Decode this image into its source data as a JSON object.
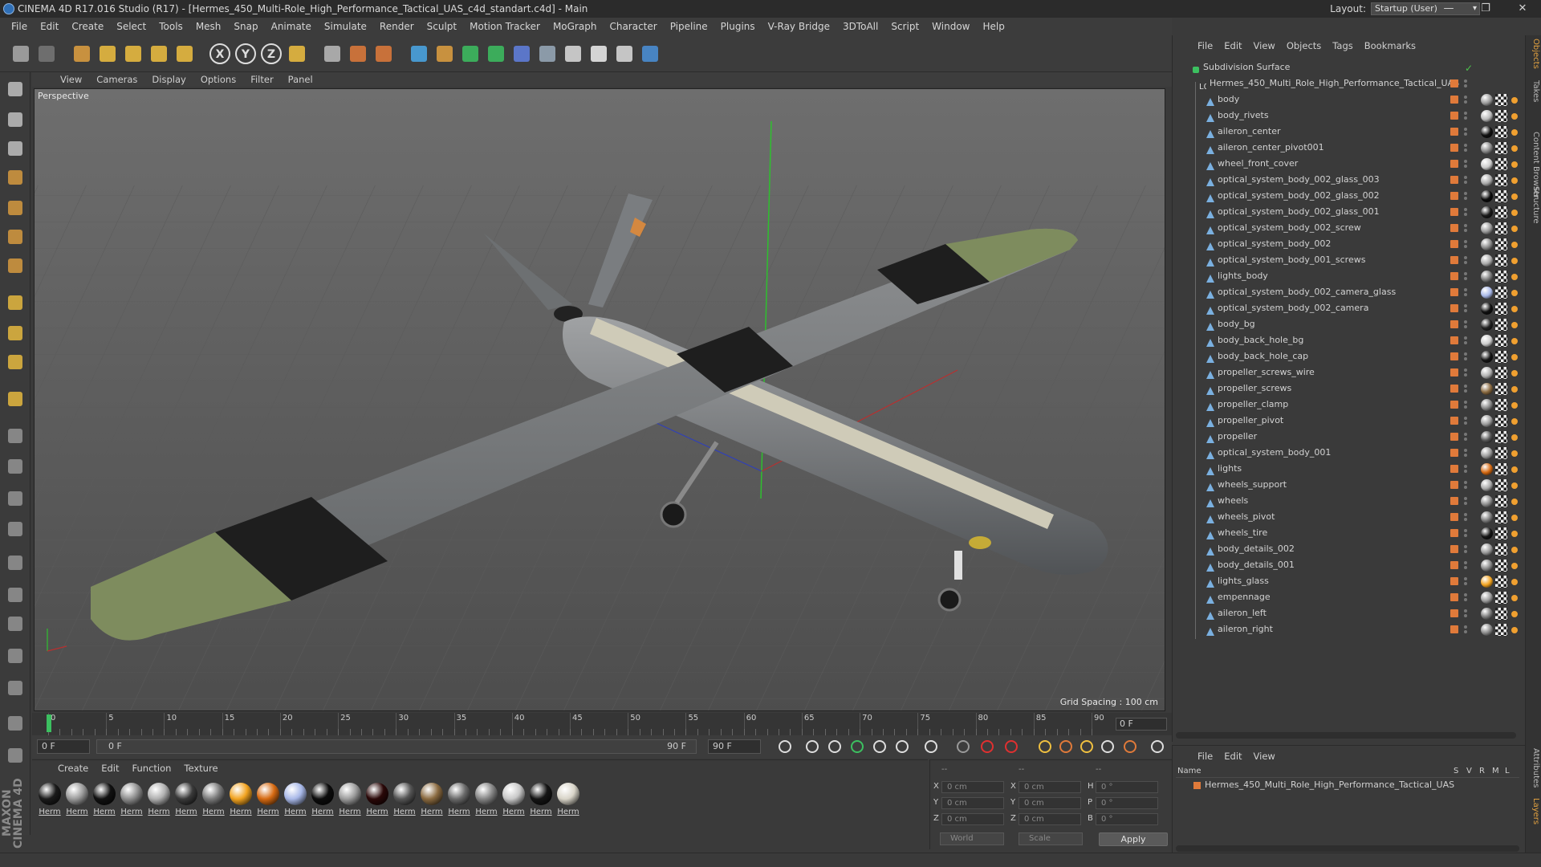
{
  "window": {
    "title": "CINEMA 4D R17.016 Studio (R17) - [Hermes_450_Multi-Role_High_Performance_Tactical_UAS_c4d_standart.c4d] - Main",
    "layout_label": "Layout:",
    "layout_value": "Startup (User)"
  },
  "menubar": [
    "File",
    "Edit",
    "Create",
    "Select",
    "Tools",
    "Mesh",
    "Snap",
    "Animate",
    "Simulate",
    "Render",
    "Sculpt",
    "Motion Tracker",
    "MoGraph",
    "Character",
    "Pipeline",
    "Plugins",
    "V-Ray Bridge",
    "3DToAll",
    "Script",
    "Window",
    "Help"
  ],
  "toolbar_icons": [
    "undo-icon",
    "redo-icon",
    "live-selection-icon",
    "move-icon",
    "scale-icon",
    "rotate-icon",
    "recent-tool-icon",
    "x-axis-icon",
    "y-axis-icon",
    "z-axis-icon",
    "coordinate-system-icon",
    "render-view-icon",
    "render-picture-viewer-icon",
    "render-settings-icon",
    "cube-icon",
    "pen-spline-icon",
    "subdivision-nurbs-icon",
    "cloner-icon",
    "deformer-icon",
    "floor-icon",
    "camera-icon",
    "light-icon",
    "vray-icon",
    "python-icon"
  ],
  "viewport": {
    "menu": [
      "View",
      "Cameras",
      "Display",
      "Options",
      "Filter",
      "Panel"
    ],
    "label": "Perspective",
    "grid_spacing": "Grid Spacing : 100 cm"
  },
  "timeline": {
    "ticks": [
      "0",
      "5",
      "10",
      "15",
      "20",
      "25",
      "30",
      "35",
      "40",
      "45",
      "50",
      "55",
      "60",
      "65",
      "70",
      "75",
      "80",
      "85",
      "90"
    ],
    "current_frame": "0 F"
  },
  "transport": {
    "start": "0 F",
    "range_start": "0 F",
    "range_end": "90 F",
    "end": "90 F"
  },
  "material_panel": {
    "menu": [
      "Create",
      "Edit",
      "Function",
      "Texture"
    ],
    "materials": [
      {
        "label": "Herm",
        "color": "#1a1a1a"
      },
      {
        "label": "Herm",
        "color": "#9a9a9a"
      },
      {
        "label": "Herm",
        "color": "#111111"
      },
      {
        "label": "Herm",
        "color": "#8e8e8e"
      },
      {
        "label": "Herm",
        "color": "#b0b0b0"
      },
      {
        "label": "Herm",
        "color": "#3a3a3a"
      },
      {
        "label": "Herm",
        "color": "#7a7a7a"
      },
      {
        "label": "Herm",
        "color": "#f2a320"
      },
      {
        "label": "Herm",
        "color": "#d66a12"
      },
      {
        "label": "Herm",
        "color": "#a8b8e8"
      },
      {
        "label": "Herm",
        "color": "#0c0c0c"
      },
      {
        "label": "Herm",
        "color": "#9c9c9c"
      },
      {
        "label": "Herm",
        "color": "#2a0808"
      },
      {
        "label": "Herm",
        "color": "#555555"
      },
      {
        "label": "Herm",
        "color": "#8a6a40"
      },
      {
        "label": "Herm",
        "color": "#6a6a6a"
      },
      {
        "label": "Herm",
        "color": "#858585"
      },
      {
        "label": "Herm",
        "color": "#c8c8c8"
      },
      {
        "label": "Herm",
        "color": "#151515"
      },
      {
        "label": "Herm",
        "color": "#d8d4c8"
      }
    ]
  },
  "coords": {
    "header": [
      "--",
      "--",
      "--"
    ],
    "rows": [
      {
        "a": "X",
        "v1": "0 cm",
        "b": "X",
        "v2": "0 cm",
        "c": "H",
        "v3": "0 °"
      },
      {
        "a": "Y",
        "v1": "0 cm",
        "b": "Y",
        "v2": "0 cm",
        "c": "P",
        "v3": "0 °"
      },
      {
        "a": "Z",
        "v1": "0 cm",
        "b": "Z",
        "v2": "0 cm",
        "c": "B",
        "v3": "0 °"
      }
    ],
    "mode1": "World",
    "mode2": "Scale",
    "apply": "Apply"
  },
  "object_manager": {
    "menu": [
      "File",
      "Edit",
      "View",
      "Objects",
      "Tags",
      "Bookmarks"
    ],
    "root": "Subdivision Surface",
    "group": "Hermes_450_Multi_Role_High_Performance_Tactical_UAS",
    "objects": [
      {
        "name": "body",
        "mat": "#9a9a9a"
      },
      {
        "name": "body_rivets",
        "mat": "#bbbbbb"
      },
      {
        "name": "aileron_center",
        "mat": "#111111"
      },
      {
        "name": "aileron_center_pivot001",
        "mat": "#888888"
      },
      {
        "name": "wheel_front_cover",
        "mat": "#cccccc"
      },
      {
        "name": "optical_system_body_002_glass_003",
        "mat": "#aaaaaa"
      },
      {
        "name": "optical_system_body_002_glass_002",
        "mat": "#0c0c0c"
      },
      {
        "name": "optical_system_body_002_glass_001",
        "mat": "#1a1a1a"
      },
      {
        "name": "optical_system_body_002_screw",
        "mat": "#999999"
      },
      {
        "name": "optical_system_body_002",
        "mat": "#8a8a8a"
      },
      {
        "name": "optical_system_body_001_screws",
        "mat": "#aaaaaa"
      },
      {
        "name": "lights_body",
        "mat": "#7a7a7a"
      },
      {
        "name": "optical_system_body_002_camera_glass",
        "mat": "#a8b8e8"
      },
      {
        "name": "optical_system_body_002_camera",
        "mat": "#111111"
      },
      {
        "name": "body_bg",
        "mat": "#222222"
      },
      {
        "name": "body_back_hole_bg",
        "mat": "#cccccc"
      },
      {
        "name": "body_back_hole_cap",
        "mat": "#151515"
      },
      {
        "name": "propeller_screws_wire",
        "mat": "#b0b0b0"
      },
      {
        "name": "propeller_screws",
        "mat": "#8a6a40"
      },
      {
        "name": "propeller_clamp",
        "mat": "#888888"
      },
      {
        "name": "propeller_pivot",
        "mat": "#9a9a9a"
      },
      {
        "name": "propeller",
        "mat": "#555555"
      },
      {
        "name": "optical_system_body_001",
        "mat": "#999999"
      },
      {
        "name": "lights",
        "mat": "#d66a12"
      },
      {
        "name": "wheels_support",
        "mat": "#aaaaaa"
      },
      {
        "name": "wheels",
        "mat": "#8a8a8a"
      },
      {
        "name": "wheels_pivot",
        "mat": "#7a7a7a"
      },
      {
        "name": "wheels_tire",
        "mat": "#151515"
      },
      {
        "name": "body_details_002",
        "mat": "#999999"
      },
      {
        "name": "body_details_001",
        "mat": "#888888"
      },
      {
        "name": "lights_glass",
        "mat": "#f2a320"
      },
      {
        "name": "empennage",
        "mat": "#9a9a9a"
      },
      {
        "name": "aileron_left",
        "mat": "#777777"
      },
      {
        "name": "aileron_right",
        "mat": "#888888"
      }
    ]
  },
  "layer_manager": {
    "menu": [
      "File",
      "Edit",
      "View"
    ],
    "col_name": "Name",
    "cols": [
      "S",
      "V",
      "R",
      "M",
      "L"
    ],
    "item": "Hermes_450_Multi_Role_High_Performance_Tactical_UAS"
  },
  "side_tabs": [
    "Objects",
    "Takes",
    "Content Browser",
    "Structure"
  ],
  "side_tabs_bottom": [
    "Attributes",
    "Layers"
  ],
  "branding": "MAXON CINEMA 4D",
  "colors": {
    "accent": "#e07a3a",
    "selection": "#4a90d9",
    "green_check": "#4cc14c"
  }
}
